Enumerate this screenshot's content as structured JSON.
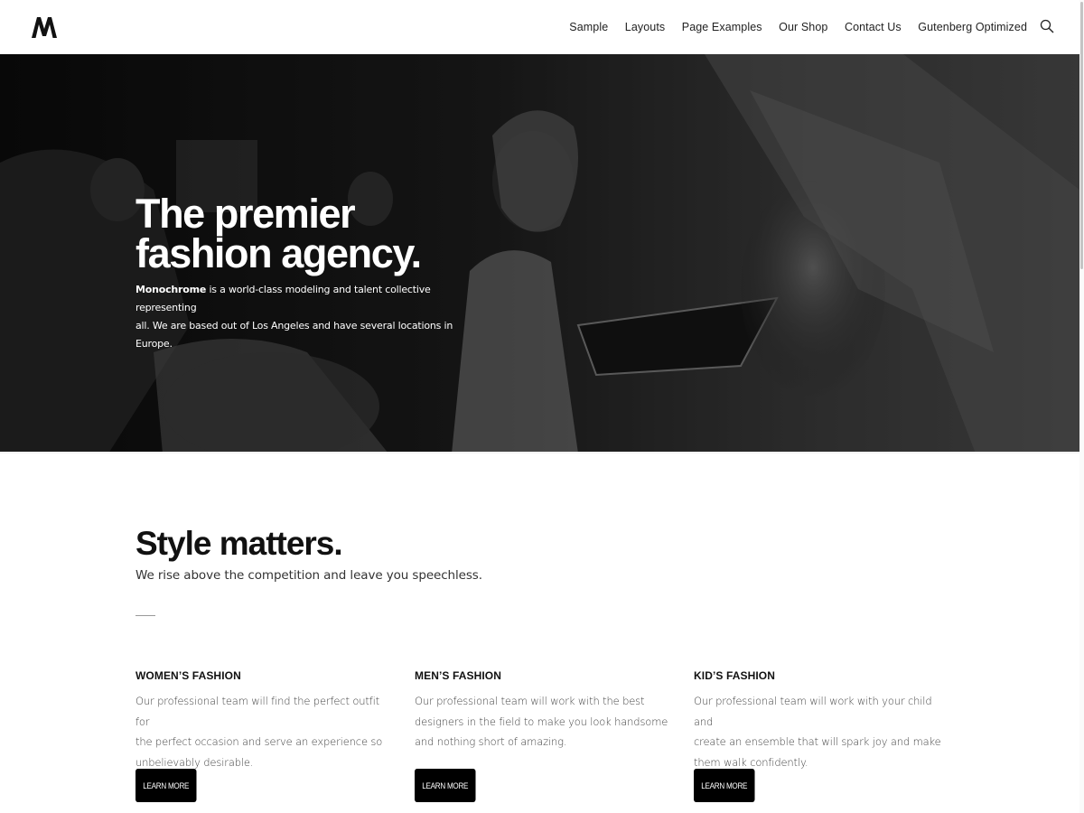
{
  "header": {
    "logo_alt": "M",
    "nav": [
      "Sample",
      "Layouts",
      "Page Examples",
      "Our Shop",
      "Contact Us",
      "Gutenberg Optimized"
    ],
    "search_icon": "search-icon"
  },
  "hero": {
    "title_line1": "The premier",
    "title_line2": "fashion agency.",
    "desc_brand": "Monochrome",
    "desc_rest1": " is a world-class modeling and talent collective representing",
    "desc_rest2": "all. We are based out of Los Angeles and have several locations in Europe."
  },
  "section": {
    "title": "Style matters.",
    "subtitle": "We rise above the competition and leave you speechless."
  },
  "columns": [
    {
      "title": "WOMEN’S FASHION",
      "lines": [
        "Our professional team will find the perfect outfit for",
        "the perfect occasion and serve an experience so",
        "unbelievably desirable."
      ],
      "button": "LEARN MORE"
    },
    {
      "title": "MEN’S FASHION",
      "lines": [
        "Our professional team will work with the best",
        "designers in the field to make you look handsome",
        "and nothing short of amazing."
      ],
      "button": "LEARN MORE"
    },
    {
      "title": "KID’S FASHION",
      "lines": [
        "Our professional team will work with your child and",
        "create an ensemble that will spark joy and make",
        "them walk confidently."
      ],
      "button": "LEARN MORE"
    }
  ],
  "colors": {
    "accent": "#000000",
    "text": "#111111",
    "muted": "#444444"
  }
}
